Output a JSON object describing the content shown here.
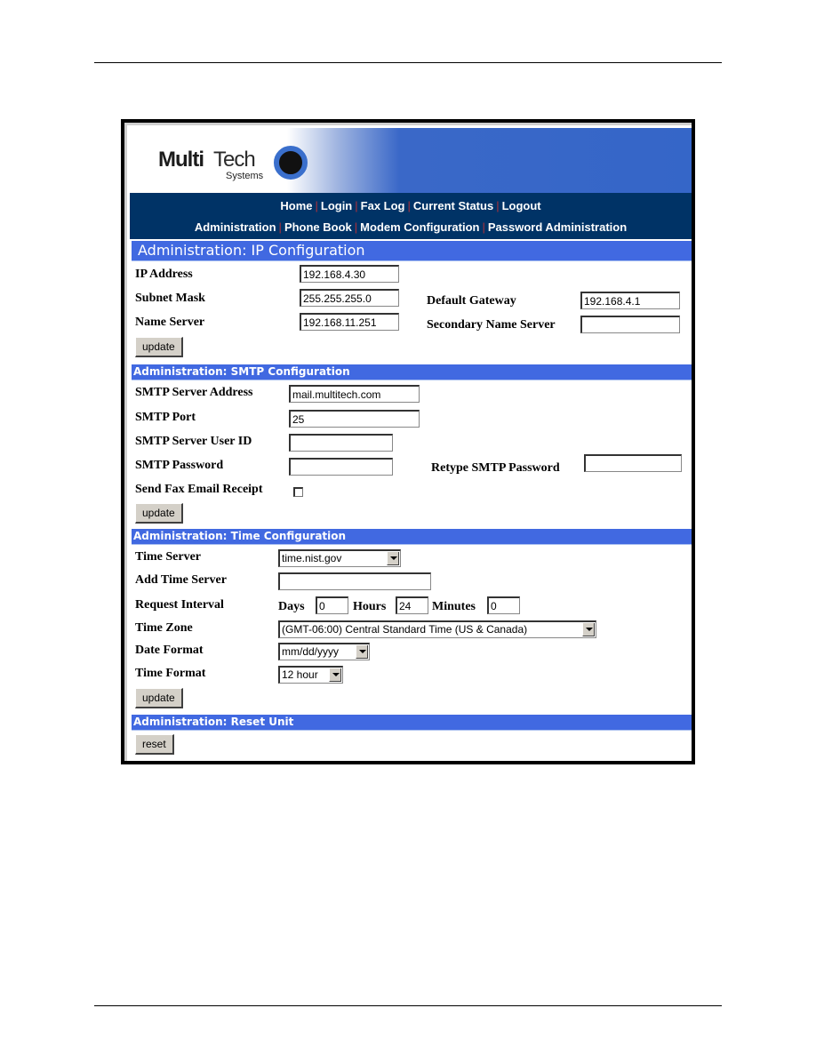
{
  "brand": {
    "name_bold": "Multi",
    "name_light": "Tech",
    "sub": "Systems"
  },
  "nav": {
    "row1": [
      "Home",
      "Login",
      "Fax Log",
      "Current Status",
      "Logout"
    ],
    "row2": [
      "Administration",
      "Phone Book",
      "Modem Configuration",
      "Password Administration"
    ],
    "separator": "|"
  },
  "ip": {
    "title": "Administration: IP Configuration",
    "ip_label": "IP Address",
    "ip_value": "192.168.4.30",
    "mask_label": "Subnet Mask",
    "mask_value": "255.255.255.0",
    "gw_label": "Default Gateway",
    "gw_value": "192.168.4.1",
    "ns_label": "Name Server",
    "ns_value": "192.168.11.251",
    "ns2_label": "Secondary Name Server",
    "ns2_value": "",
    "update": "update"
  },
  "smtp": {
    "title": "Administration: SMTP Configuration",
    "server_label": "SMTP Server Address",
    "server_value": "mail.multitech.com",
    "port_label": "SMTP Port",
    "port_value": "25",
    "user_label": "SMTP Server User ID",
    "user_value": "",
    "pass_label": "SMTP Password",
    "pass_value": "",
    "retype_label": "Retype SMTP Password",
    "retype_value": "",
    "receipt_label": "Send Fax Email Receipt",
    "receipt_checked": false,
    "update": "update"
  },
  "time": {
    "title": "Administration: Time Configuration",
    "server_label": "Time Server",
    "server_value": "time.nist.gov",
    "add_label": "Add Time Server",
    "add_value": "",
    "interval_label": "Request Interval",
    "days_label": "Days",
    "days_value": "0",
    "hours_label": "Hours",
    "hours_value": "24",
    "minutes_label": "Minutes",
    "minutes_value": "0",
    "zone_label": "Time Zone",
    "zone_value": "(GMT-06:00) Central Standard Time (US & Canada)",
    "date_label": "Date Format",
    "date_value": "mm/dd/yyyy",
    "tfmt_label": "Time Format",
    "tfmt_value": "12 hour",
    "update": "update"
  },
  "reset": {
    "title": "Administration: Reset Unit",
    "button": "reset"
  },
  "colors": {
    "nav_bg": "#003366",
    "section_bg": "#4169e1",
    "separator": "#b0303a"
  }
}
